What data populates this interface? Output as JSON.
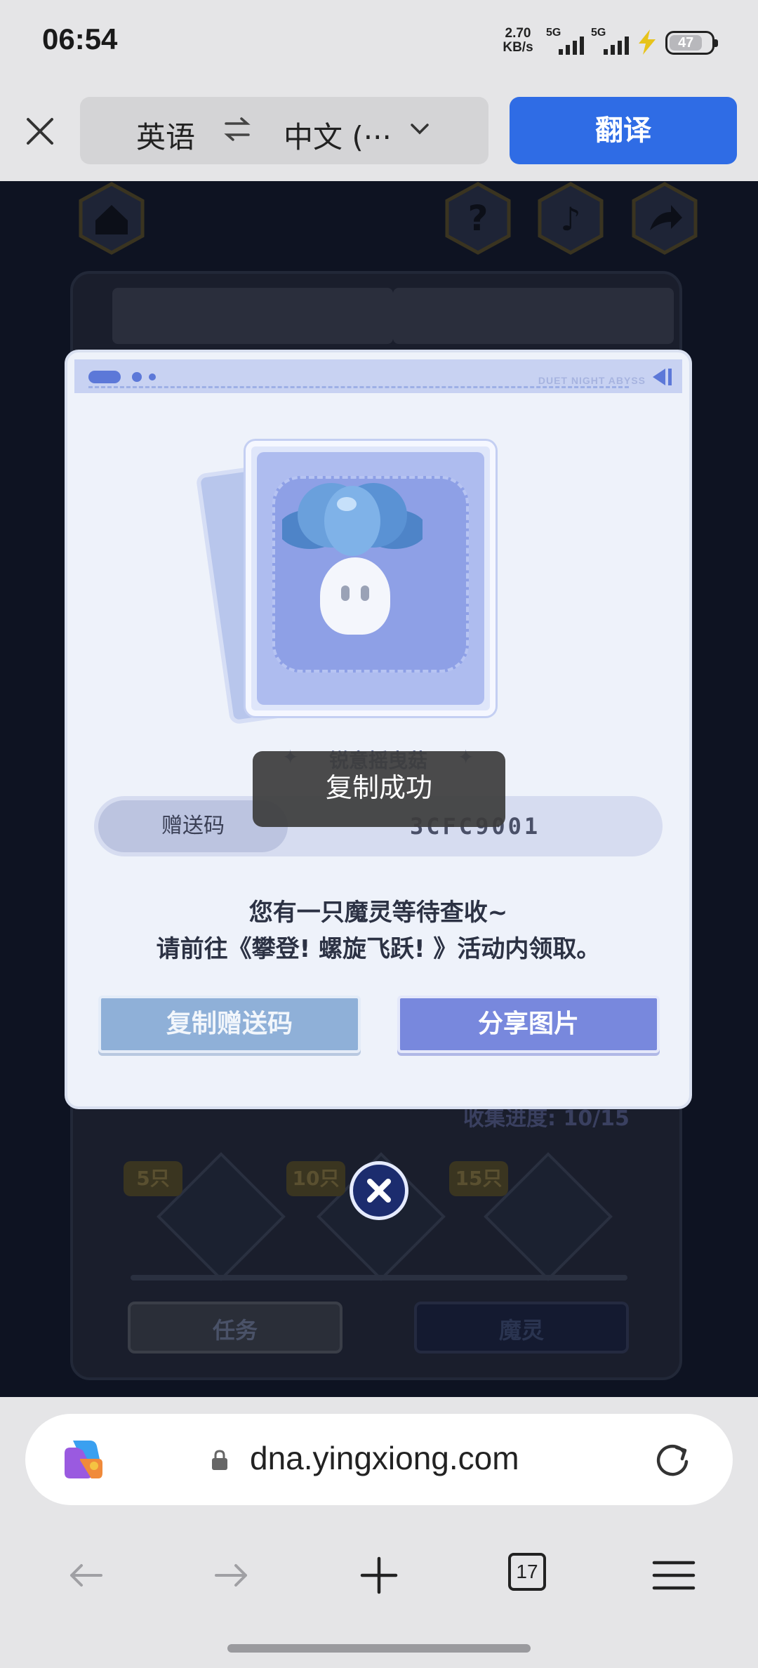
{
  "status_bar": {
    "time": "06:54",
    "net_speed_value": "2.70",
    "net_speed_unit": "KB/s",
    "signal1_label": "5G",
    "signal2_label": "5G",
    "battery_level": "47"
  },
  "translate_bar": {
    "source_lang": "英语",
    "target_lang": "中文 (···",
    "translate_label": "翻译"
  },
  "modal": {
    "brand_text": "DUET NIGHT ABYSS",
    "character_name": "锐意摇曳菇",
    "code_label": "赠送码",
    "code_value": "3CFC9001",
    "message_line1": "您有一只魔灵等待查收~",
    "message_line2": "请前往《攀登! 螺旋飞跃! 》活动内领取。",
    "copy_button": "复制赠送码",
    "share_button": "分享图片"
  },
  "toast": {
    "text": "复制成功"
  },
  "game_background": {
    "progress_text": "收集进度: 10/15",
    "milestones": [
      "5只",
      "10只",
      "15只"
    ],
    "tab_task": "任务",
    "tab_spirit": "魔灵"
  },
  "browser": {
    "url": "dna.yingxiong.com",
    "tab_count": "17"
  },
  "colors": {
    "accent": "#2f6ce5",
    "modal_bg": "#eef2fa",
    "share_button": "#7888dd",
    "copy_button": "#8fb0d8"
  },
  "icons": [
    "close-icon",
    "swap-icon",
    "chevron-down-icon",
    "home-icon",
    "help-icon",
    "music-icon",
    "share-icon",
    "copilot-icon",
    "lock-icon",
    "reload-icon",
    "back-icon",
    "forward-icon",
    "new-tab-icon",
    "tabs-icon",
    "menu-icon"
  ]
}
